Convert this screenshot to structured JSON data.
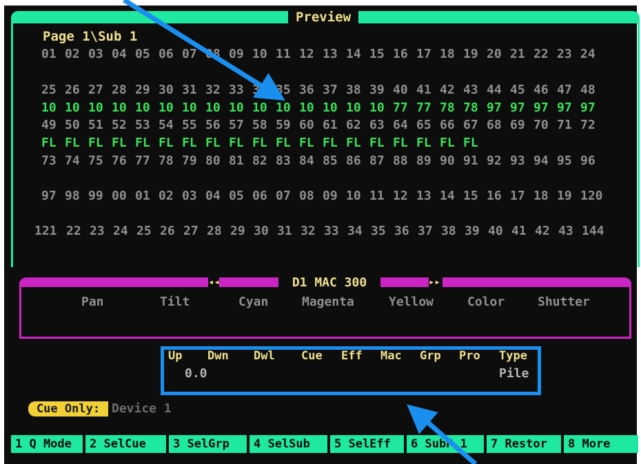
{
  "window": {
    "title": "Preview"
  },
  "page": {
    "label": "Page 1\\Sub 1"
  },
  "channel_rows": [
    {
      "numbers": [
        "01",
        "02",
        "03",
        "04",
        "05",
        "06",
        "07",
        "08",
        "09",
        "10",
        "11",
        "12",
        "13",
        "14",
        "15",
        "16",
        "17",
        "18",
        "19",
        "20",
        "21",
        "22",
        "23",
        "24"
      ],
      "levels": []
    },
    {
      "numbers": [
        "25",
        "26",
        "27",
        "28",
        "29",
        "30",
        "31",
        "32",
        "33",
        "34",
        "35",
        "36",
        "37",
        "38",
        "39",
        "40",
        "41",
        "42",
        "43",
        "44",
        "45",
        "46",
        "47",
        "48"
      ],
      "levels": [
        "10",
        "10",
        "10",
        "10",
        "10",
        "10",
        "10",
        "10",
        "10",
        "10",
        "10",
        "10",
        "10",
        "10",
        "10",
        "77",
        "77",
        "78",
        "78",
        "97",
        "97",
        "97",
        "97",
        "97"
      ]
    },
    {
      "numbers": [
        "49",
        "50",
        "51",
        "52",
        "53",
        "54",
        "55",
        "56",
        "57",
        "58",
        "59",
        "60",
        "61",
        "62",
        "63",
        "64",
        "65",
        "66",
        "67",
        "68",
        "69",
        "70",
        "71",
        "72"
      ],
      "levels": [
        "FL",
        "FL",
        "FL",
        "FL",
        "FL",
        "FL",
        "FL",
        "FL",
        "FL",
        "FL",
        "FL",
        "FL",
        "FL",
        "FL",
        "FL",
        "FL",
        "FL",
        "FL",
        "FL"
      ]
    },
    {
      "numbers": [
        "73",
        "74",
        "75",
        "76",
        "77",
        "78",
        "79",
        "80",
        "81",
        "82",
        "83",
        "84",
        "85",
        "86",
        "87",
        "88",
        "89",
        "90",
        "91",
        "92",
        "93",
        "94",
        "95",
        "96"
      ],
      "levels": []
    },
    {
      "numbers": [
        "97",
        "98",
        "99",
        "00",
        "01",
        "02",
        "03",
        "04",
        "05",
        "06",
        "07",
        "08",
        "09",
        "10",
        "11",
        "12",
        "13",
        "14",
        "15",
        "16",
        "17",
        "18",
        "19",
        "120"
      ],
      "levels": []
    },
    {
      "numbers": [
        "121",
        "22",
        "23",
        "24",
        "25",
        "26",
        "27",
        "28",
        "29",
        "30",
        "31",
        "32",
        "33",
        "34",
        "35",
        "36",
        "37",
        "38",
        "39",
        "40",
        "41",
        "42",
        "43",
        "144"
      ],
      "levels": []
    }
  ],
  "device_panel": {
    "title": "D1  MAC 300",
    "left_arrow": "◂◂",
    "right_arrow": "▸▸",
    "params": [
      "Pan",
      "Tilt",
      "Cyan",
      "Magenta",
      "Yellow",
      "Color",
      "Shutter"
    ]
  },
  "cue_info": {
    "headers": [
      "Up",
      "Dwn",
      "Dwl",
      "Cue",
      "Eff",
      "Mac",
      "Grp",
      "Pro",
      "Type"
    ],
    "up_value": "0.0",
    "type_value": "Pile"
  },
  "status": {
    "mode_badge": "Cue Only:",
    "device": "Device 1"
  },
  "function_keys": [
    "1 Q Mode",
    "2 SelCue",
    "3 SelGrp",
    "4 SelSub",
    "5 SelEff",
    "6 SubP 1",
    "7 Restor",
    "8 More"
  ],
  "colors": {
    "accent_green": "#1fe8a0",
    "panel_magenta": "#cc24c4",
    "label_yellow": "#f0e090",
    "level_green": "#3be05a",
    "annotation_blue": "#1a8ff0"
  }
}
